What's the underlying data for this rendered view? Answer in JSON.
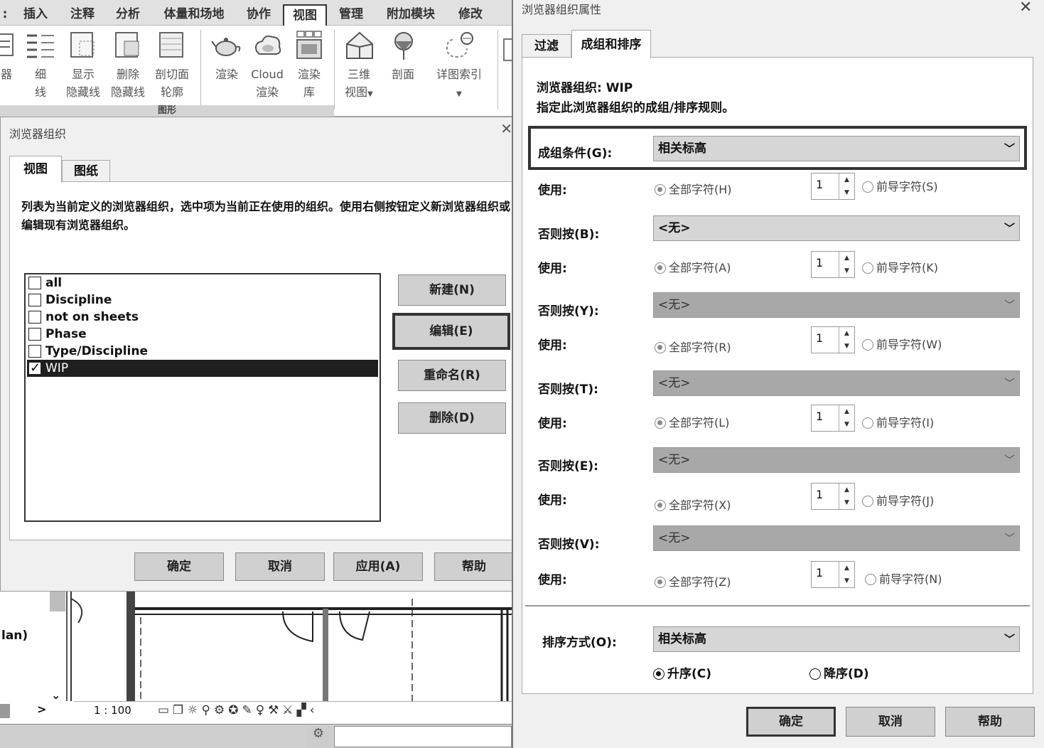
{
  "ribbon": {
    "tabs": [
      "插入",
      "注释",
      "分析",
      "体量和场地",
      "协作",
      "视图",
      "管理",
      "附加模块",
      "修改"
    ],
    "active_tab": "视图",
    "tools": [
      {
        "line1": "器",
        "line2": ""
      },
      {
        "line1": "细",
        "line2": "线"
      },
      {
        "line1": "显示",
        "line2": "隐藏线"
      },
      {
        "line1": "删除",
        "line2": "隐藏线"
      },
      {
        "line1": "剖切面",
        "line2": "轮廓"
      },
      {
        "line1": "渲染",
        "line2": ""
      },
      {
        "line1": "Cloud",
        "line2": "渲染"
      },
      {
        "line1": "渲染",
        "line2": "库"
      },
      {
        "line1": "三维",
        "line2": "视图"
      },
      {
        "line1": "剖面",
        "line2": ""
      },
      {
        "line1": "详图索引",
        "line2": ""
      }
    ],
    "panel_label": "图形"
  },
  "browser_org_dialog": {
    "title": "浏览器组织",
    "tabs": [
      "视图",
      "图纸"
    ],
    "description": "列表为当前定义的浏览器组织，选中项为当前正在使用的组织。使用右侧按钮定义新浏览器组织或编辑现有浏览器组织。",
    "items": [
      {
        "label": "all",
        "checked": false
      },
      {
        "label": "Discipline",
        "checked": false
      },
      {
        "label": "not on sheets",
        "checked": false
      },
      {
        "label": "Phase",
        "checked": false
      },
      {
        "label": "Type/Discipline",
        "checked": false
      },
      {
        "label": "WIP",
        "checked": true
      }
    ],
    "buttons": {
      "new": "新建(N)",
      "edit": "编辑(E)",
      "rename": "重命名(R)",
      "delete": "删除(D)"
    },
    "footer": {
      "ok": "确定",
      "cancel": "取消",
      "apply": "应用(A)",
      "help": "帮助"
    }
  },
  "props_dialog": {
    "title": "浏览器组织属性",
    "tabs": [
      "过滤",
      "成组和排序"
    ],
    "org_line": "浏览器组织: WIP",
    "desc_line": "指定此浏览器组织的成组/排序规则。",
    "group_label": "成组条件(G):",
    "group_value": "相关标高",
    "use_label": "使用:",
    "rows": [
      {
        "all": "全部字符(H)",
        "spin": "1",
        "lead": "前导字符(S)"
      },
      {
        "label": "否则按(B):",
        "value": "<无>",
        "all": "全部字符(A)",
        "spin": "1",
        "lead": "前导字符(K)"
      },
      {
        "label": "否则按(Y):",
        "value": "<无>",
        "all": "全部字符(R)",
        "spin": "1",
        "lead": "前导字符(W)"
      },
      {
        "label": "否则按(T):",
        "value": "<无>",
        "all": "全部字符(L)",
        "spin": "1",
        "lead": "前导字符(I)"
      },
      {
        "label": "否则按(E):",
        "value": "<无>",
        "all": "全部字符(X)",
        "spin": "1",
        "lead": "前导字符(J)"
      },
      {
        "label": "否则按(V):",
        "value": "<无>",
        "all": "全部字符(Z)",
        "spin": "1",
        "lead": "前导字符(N)"
      }
    ],
    "sort_label": "排序方式(O):",
    "sort_value": "相关标高",
    "asc": "升序(C)",
    "desc": "降序(D)",
    "footer": {
      "ok": "确定",
      "cancel": "取消",
      "help": "帮助"
    }
  },
  "background": {
    "side_label": "lan)",
    "scale": "1 : 100"
  }
}
